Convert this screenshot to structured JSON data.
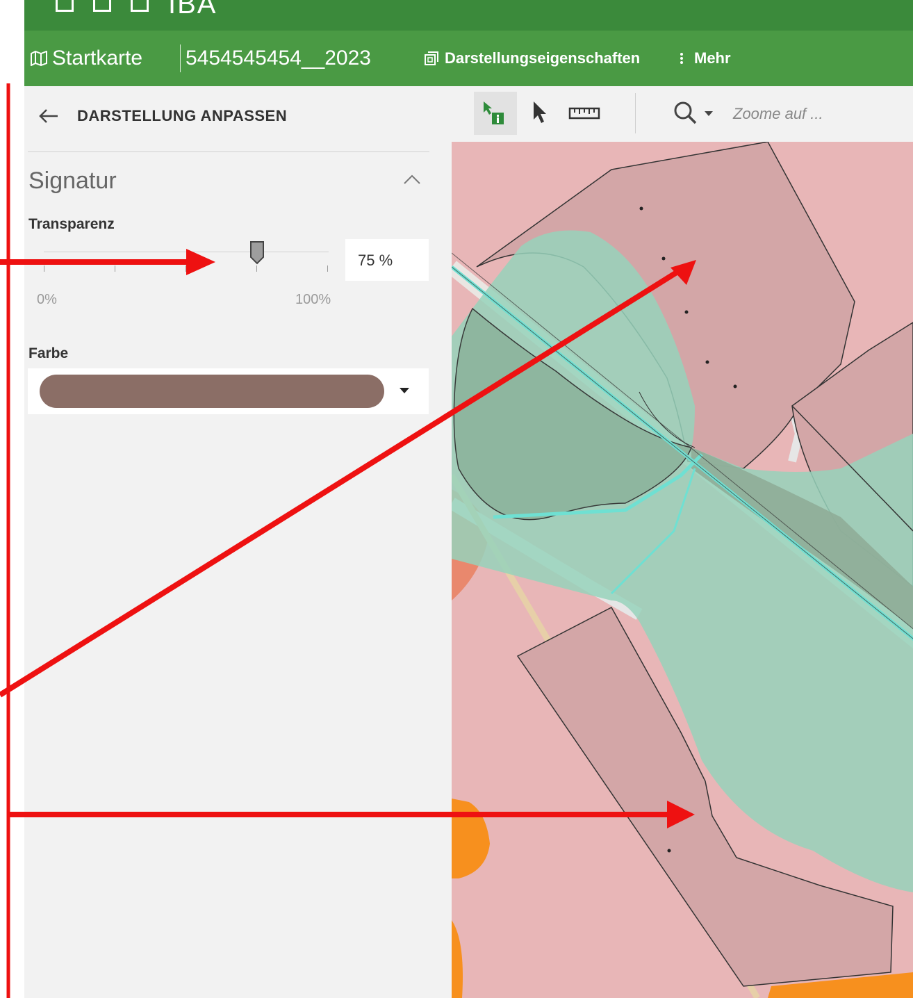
{
  "header": {
    "brand": "IBA"
  },
  "subbar": {
    "map_label": "Startkarte",
    "project": "5454545454__2023",
    "display_props": "Darstellungseigenschaften",
    "more": "Mehr"
  },
  "panel": {
    "back_label": "DARSTELLUNG ANPASSEN",
    "section_title": "Signatur",
    "transparency_label": "Transparenz",
    "transparency_value": "75  %",
    "slider_min": "0%",
    "slider_max": "100%",
    "slider_level_percent": 75,
    "color_label": "Farbe",
    "color_value": "#8b6e66"
  },
  "toolbar": {
    "zoom_placeholder": "Zoome auf ..."
  },
  "colors": {
    "topbar": "#3b8a3b",
    "subbar": "#4a9a44",
    "map_pink": "#e8b6b7",
    "parcel_brown": "#d3a6a7",
    "area_green": "#96d2bb",
    "water_cyan": "#6fe0d2",
    "orange": "#f7901e",
    "annotation_red": "#ee1111"
  },
  "icons": [
    "map-icon",
    "layers-icon",
    "kebab-icon",
    "back-arrow-icon",
    "chevron-up-icon",
    "info-select-icon",
    "pointer-icon",
    "ruler-icon",
    "search-icon"
  ]
}
